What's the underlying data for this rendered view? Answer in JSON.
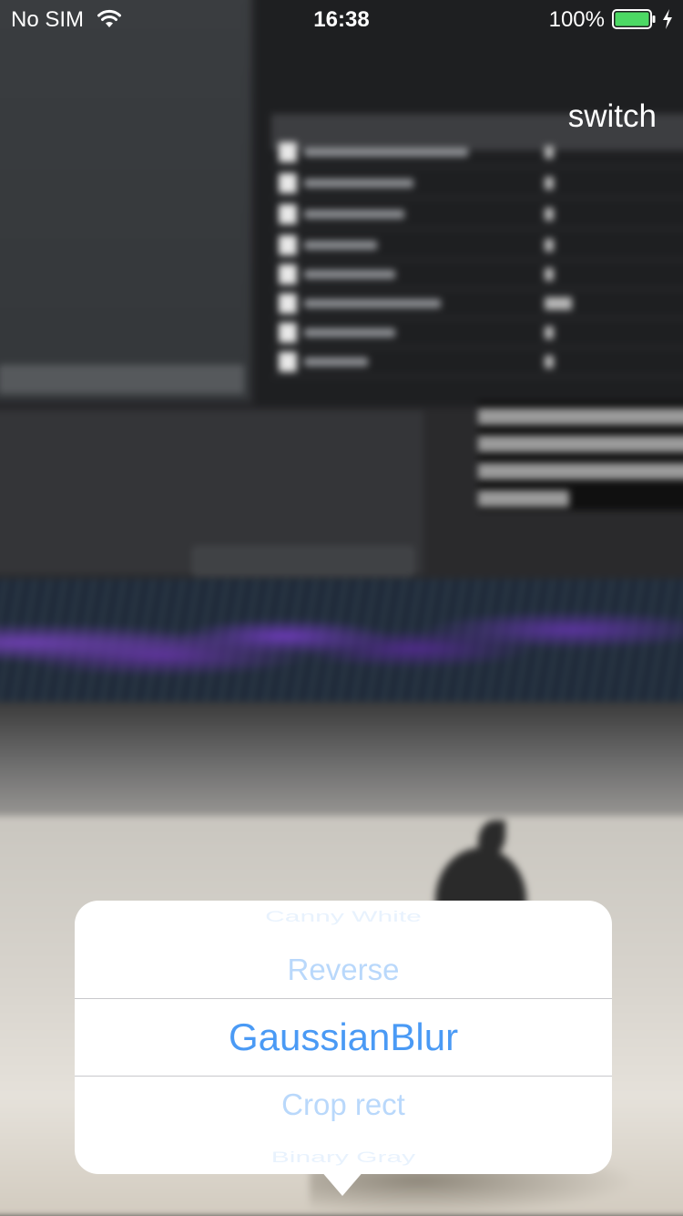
{
  "status_bar": {
    "carrier": "No SIM",
    "time": "16:38",
    "battery_percent": "100%",
    "battery_level": 1.0,
    "battery_color": "#4cd964",
    "icons": [
      "wifi-icon",
      "battery-icon",
      "charging-icon"
    ]
  },
  "toolbar": {
    "switch_label": "switch"
  },
  "picker": {
    "accent_color": "#4a9af5",
    "items": [
      "Canny White",
      "Reverse",
      "GaussianBlur",
      "Crop rect",
      "Binary Gray"
    ],
    "selected_index": 2
  }
}
